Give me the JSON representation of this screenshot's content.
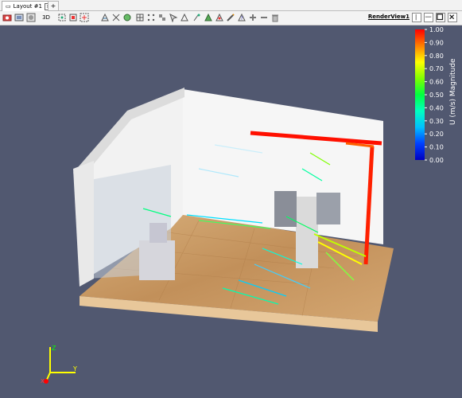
{
  "tab": {
    "label": "Layout #1"
  },
  "toolbar": {
    "mode_label": "3D",
    "view_title": "RenderView1",
    "icons": [
      "camera-icon",
      "screenshot-icon",
      "capture-icon",
      "mode-3d",
      "reset-camera-icon",
      "zoom-to-data-icon",
      "zoom-to-box-icon",
      "orientation-axes-icon",
      "rotate-icon",
      "view-x-icon",
      "view-y-icon",
      "view-z-icon",
      "select-cells-icon",
      "select-points-icon",
      "select-blocks-icon",
      "interactive-select-icon",
      "hover-points-icon",
      "plus-icon",
      "minus-icon",
      "trash-icon"
    ]
  },
  "legend": {
    "title": "U (m/s) Magnitude",
    "ticks": [
      "1.00",
      "0.90",
      "0.80",
      "0.70",
      "0.60",
      "0.50",
      "0.40",
      "0.30",
      "0.20",
      "0.10",
      "0.00"
    ],
    "colors": [
      "#ff0000",
      "#ff8000",
      "#ffff00",
      "#80ff00",
      "#00ff40",
      "#00ffc0",
      "#00c0ff",
      "#0040ff",
      "#0000c0"
    ]
  },
  "axes": {
    "x": "X",
    "y": "Y",
    "z": "Z"
  },
  "colors": {
    "background": "#515870",
    "floor": "#c99a64",
    "wall": "#f4f4f4"
  }
}
